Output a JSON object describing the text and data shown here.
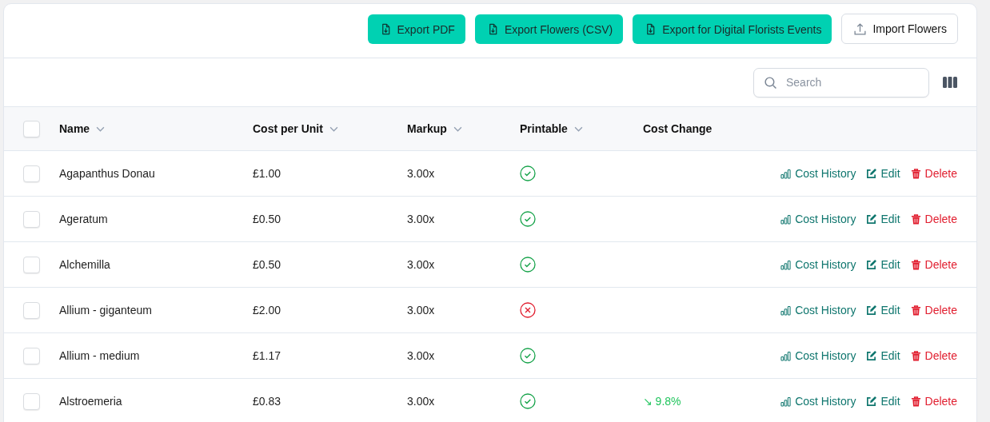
{
  "toolbar": {
    "buttons": [
      {
        "label": "Export PDF",
        "kind": "export"
      },
      {
        "label": "Export Flowers (CSV)",
        "kind": "export"
      },
      {
        "label": "Export for Digital Florists Events",
        "kind": "export"
      },
      {
        "label": "Import Flowers",
        "kind": "import"
      }
    ]
  },
  "search": {
    "placeholder": "Search"
  },
  "table": {
    "columns": [
      {
        "label": "Name",
        "sortable": true
      },
      {
        "label": "Cost per Unit",
        "sortable": true
      },
      {
        "label": "Markup",
        "sortable": true
      },
      {
        "label": "Printable",
        "sortable": true
      },
      {
        "label": "Cost Change",
        "sortable": false
      }
    ],
    "select_all": {
      "checked": false
    },
    "rows": [
      {
        "name": "Agapanthus Donau",
        "cost": "£1.00",
        "markup": "3.00x",
        "printable": true,
        "checked": false,
        "actions": [
          "Cost History",
          "Edit",
          "Delete"
        ]
      },
      {
        "name": "Ageratum",
        "cost": "£0.50",
        "markup": "3.00x",
        "printable": true,
        "checked": false,
        "actions": [
          "Cost History",
          "Edit",
          "Delete"
        ]
      },
      {
        "name": "Alchemilla",
        "cost": "£0.50",
        "markup": "3.00x",
        "printable": true,
        "checked": false,
        "actions": [
          "Cost History",
          "Edit",
          "Delete"
        ]
      },
      {
        "name": "Allium - giganteum",
        "cost": "£2.00",
        "markup": "3.00x",
        "printable": false,
        "checked": false,
        "actions": [
          "Cost History",
          "Edit",
          "Delete"
        ]
      },
      {
        "name": "Allium - medium",
        "cost": "£1.17",
        "markup": "3.00x",
        "printable": true,
        "checked": false,
        "actions": [
          "Cost History",
          "Edit",
          "Delete"
        ]
      },
      {
        "name": "Alstroemeria",
        "cost": "£0.83",
        "markup": "3.00x",
        "printable": true,
        "cost_change": "↘ 9.8%",
        "checked": false,
        "actions": [
          "Cost History",
          "Edit",
          "Delete"
        ]
      }
    ]
  }
}
